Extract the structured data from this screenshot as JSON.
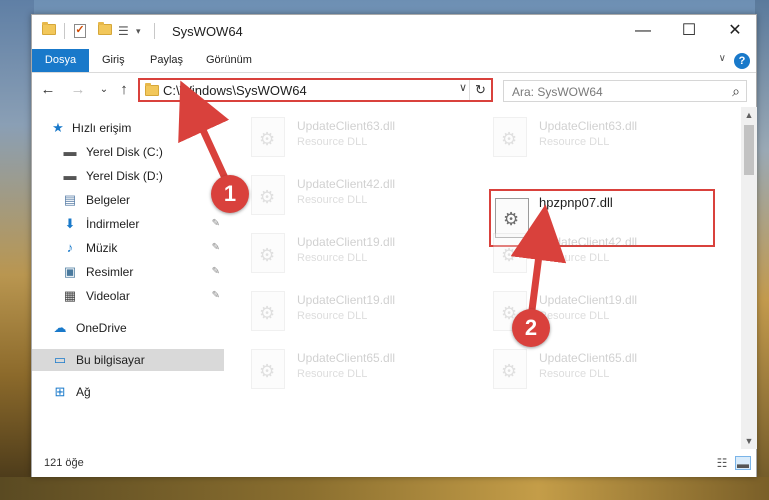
{
  "window": {
    "title": "SysWOW64",
    "minimize": "—",
    "maximize": "☐",
    "close": "✕"
  },
  "ribbon": {
    "tabs": [
      "Dosya",
      "Giriş",
      "Paylaş",
      "Görünüm"
    ],
    "help": "?",
    "collapse": "∨"
  },
  "nav": {
    "back": "←",
    "forward": "→",
    "recent": "⌄",
    "up": "↑",
    "address": "C:\\Windows\\SysWOW64",
    "address_dropdown": "∨",
    "refresh": "↻",
    "search_placeholder": "Ara: SysWOW64",
    "search_icon": "⌕"
  },
  "sidebar": {
    "items": [
      {
        "label": "Hızlı erişim",
        "icon": "star-icon",
        "glyph": "★",
        "color": "#1979ca"
      },
      {
        "label": "Yerel Disk (C:)",
        "icon": "drive-icon",
        "glyph": "▬",
        "color": "#555555"
      },
      {
        "label": "Yerel Disk (D:)",
        "icon": "drive-icon",
        "glyph": "▬",
        "color": "#555555"
      },
      {
        "label": "Belgeler",
        "icon": "documents-icon",
        "glyph": "▤",
        "color": "#5a7fa8"
      },
      {
        "label": "İndirmeler",
        "icon": "download-icon",
        "glyph": "⬇",
        "color": "#1979ca"
      },
      {
        "label": "Müzik",
        "icon": "music-icon",
        "glyph": "♪",
        "color": "#1979ca"
      },
      {
        "label": "Resimler",
        "icon": "pictures-icon",
        "glyph": "▣",
        "color": "#4a7a9e"
      },
      {
        "label": "Videolar",
        "icon": "videos-icon",
        "glyph": "▦",
        "color": "#444444"
      },
      {
        "label": "OneDrive",
        "icon": "onedrive-icon",
        "glyph": "☁",
        "color": "#1979ca"
      },
      {
        "label": "Bu bilgisayar",
        "icon": "computer-icon",
        "glyph": "▭",
        "color": "#1979ca"
      },
      {
        "label": "Ağ",
        "icon": "network-icon",
        "glyph": "⊞",
        "color": "#1979ca"
      }
    ],
    "pin_glyph": "📌"
  },
  "files": {
    "left_column": [
      {
        "name": "UpdateClient63.dll",
        "desc": "Resource DLL"
      },
      {
        "name": "UpdateClient42.dll",
        "desc": "Resource DLL"
      },
      {
        "name": "UpdateClient19.dll",
        "desc": "Resource DLL"
      },
      {
        "name": "UpdateClient19.dll",
        "desc": "Resource DLL"
      },
      {
        "name": "UpdateClient65.dll",
        "desc": "Resource DLL"
      }
    ],
    "right_column": [
      {
        "name": "UpdateClient63.dll",
        "desc": "Resource DLL"
      },
      {
        "name": "UpdateClient42.dll",
        "desc": "Resource DLL"
      },
      {
        "name": "UpdateClient19.dll",
        "desc": "Resource DLL"
      },
      {
        "name": "UpdateClient65.dll",
        "desc": "Resource DLL"
      }
    ],
    "highlighted": {
      "name": "hpzpnp07.dll"
    }
  },
  "status": {
    "count": "121 öğe"
  },
  "annotations": {
    "step1": "1",
    "step2": "2",
    "color": "#d9413c"
  }
}
